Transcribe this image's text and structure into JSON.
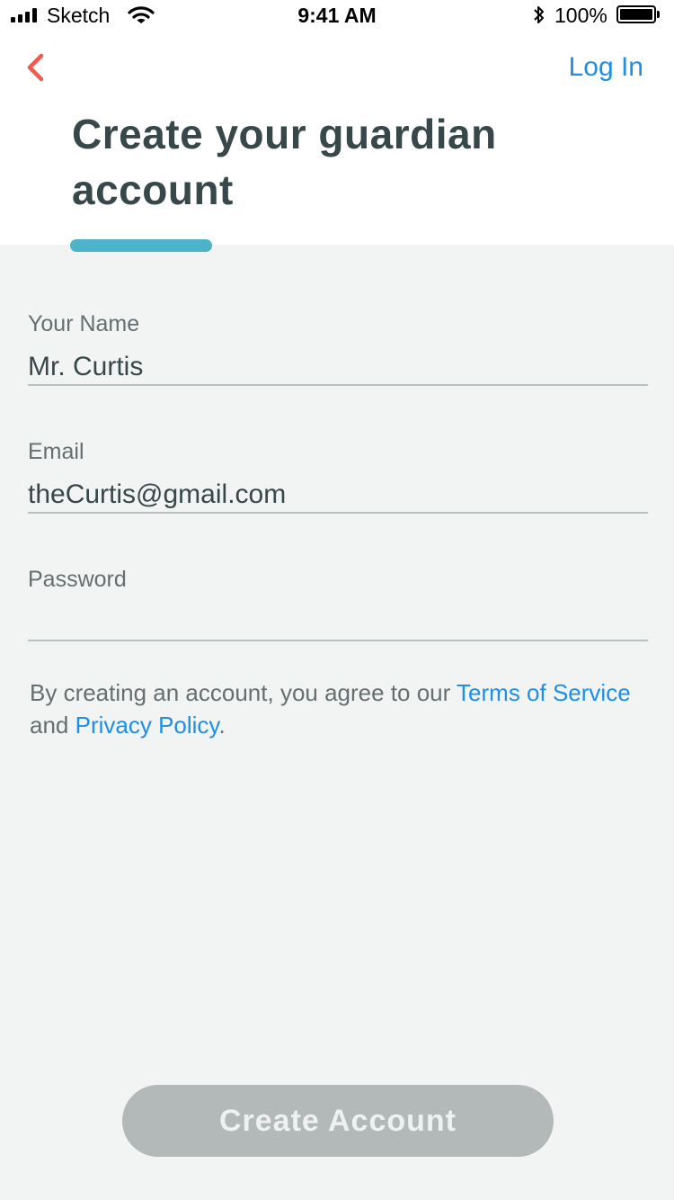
{
  "status_bar": {
    "carrier": "Sketch",
    "time": "9:41 AM",
    "battery_percent": "100%",
    "battery_level": 1.0
  },
  "nav": {
    "back_icon": "chevron-left-icon",
    "login_label": "Log In"
  },
  "header": {
    "title": "Create your guardian account"
  },
  "form": {
    "name": {
      "label": "Your Name",
      "value": "Mr. Curtis"
    },
    "email": {
      "label": "Email",
      "value": "theCurtis@gmail.com"
    },
    "password": {
      "label": "Password",
      "value": ""
    }
  },
  "terms": {
    "prefix": "By creating an account, you agree to our ",
    "terms_link": "Terms of Service",
    "middle": " and ",
    "privacy_link": "Privacy Policy",
    "suffix": "."
  },
  "actions": {
    "create_label": "Create Account"
  },
  "colors": {
    "accent_link": "#1e8ee6",
    "back_arrow": "#f05a4f",
    "title_underline": "#4cb3c9",
    "title_text": "#37474a",
    "button_disabled": "#b2b9b8",
    "background": "#f2f4f3"
  }
}
